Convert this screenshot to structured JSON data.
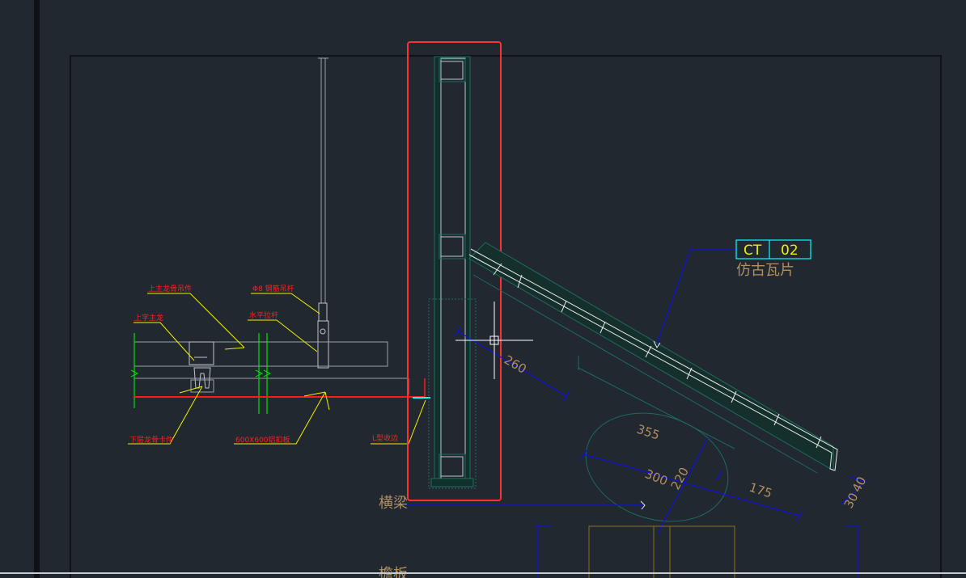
{
  "colors": {
    "background": "#212830",
    "frame": "#0a0d10",
    "red": "#ff1a1a",
    "yellow": "#f0f000",
    "green": "#00e000",
    "blue": "#1010e0",
    "cyan": "#00ffff",
    "white": "#e8e8e8",
    "tan": "#b09060",
    "teal": "#1e6b60",
    "selection": "#ff3030"
  },
  "tags": {
    "ct_left": "CT",
    "ct_right": "02"
  },
  "labels": {
    "antique_tile": "仿古瓦片",
    "crossbeam": "横梁",
    "bottom_partial": "檐板",
    "main_keel_hanger": "上主龙骨吊件",
    "steel_rod": "Φ8 钢筋吊杆",
    "t_main": "上字主龙",
    "horizontal_tie": "水平拉杆",
    "lower_keel": "下层龙骨卡件",
    "aluminum_panel": "600X600铝扣板",
    "edge_strip": "L型收边"
  },
  "dimensions": {
    "d260": "260",
    "d355": "355",
    "d300": "300",
    "d220": "220",
    "d175": "175",
    "d30": "30",
    "d40": "40"
  },
  "icons": {
    "crosshair": "crosshair-cursor-icon"
  }
}
